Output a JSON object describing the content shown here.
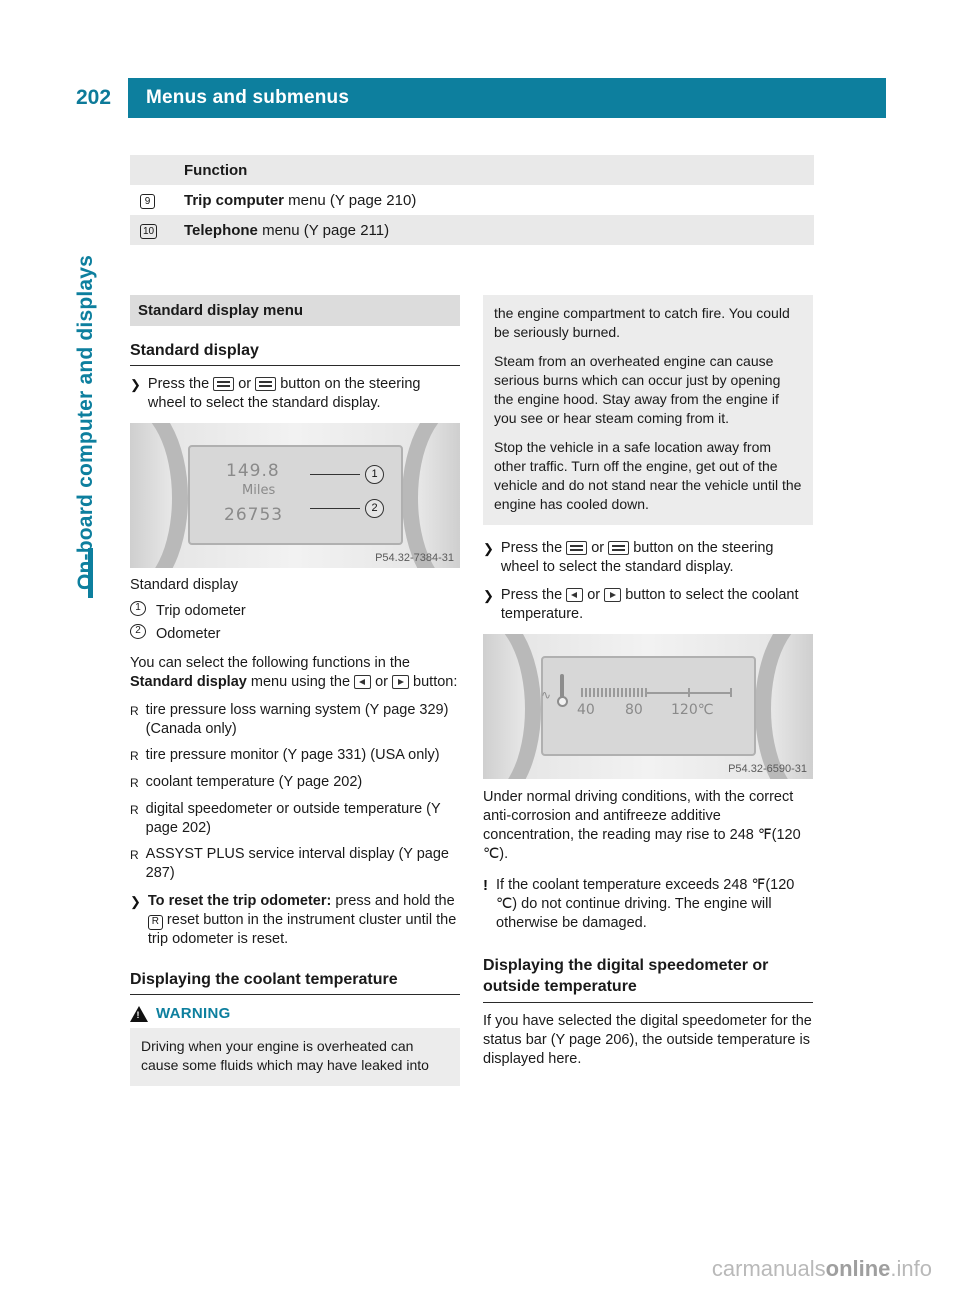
{
  "header": {
    "page_number": "202",
    "title": "Menus and submenus"
  },
  "side_title": "On-board computer and displays",
  "function_table": {
    "header": "Function",
    "rows": [
      {
        "symbol": "9",
        "label_bold": "Trip computer",
        "label_rest": " menu (Y page 210)"
      },
      {
        "symbol": "10",
        "label_bold": "Telephone",
        "label_rest": " menu (Y page 211)"
      }
    ]
  },
  "left": {
    "section_title": "Standard display menu",
    "subhead_standard_display": "Standard display",
    "press_button_text": "button on the steering wheel to select the standard display.",
    "press_prefix": "Press the",
    "or_word": "or",
    "illustration1": {
      "line1": "149.8",
      "line2": "Miles",
      "line3": "26753",
      "callout1": "1",
      "callout2": "2",
      "code": "P54.32-7384-31"
    },
    "legend_title": "Standard display",
    "legend": [
      {
        "mark": "1",
        "text": "Trip odometer"
      },
      {
        "mark": "2",
        "text": "Odometer"
      }
    ],
    "select_intro_a": "You can select the following functions in the ",
    "select_intro_bold": "Standard display",
    "select_intro_b": " menu using the ",
    "select_intro_c": " or ",
    "select_intro_d": " button:",
    "function_bullets": [
      "tire pressure loss warning system (Y page 329) (Canada only)",
      "tire pressure monitor (Y page 331) (USA only)",
      "coolant temperature (Y page 202)",
      "digital speedometer or outside temperature (Y page 202)",
      "ASSYST PLUS service interval display (Y page 287)"
    ],
    "reset_bold": "To reset the trip odometer:",
    "reset_text_a": " press and hold the ",
    "reset_text_b": " reset button in the instrument cluster until the trip odometer is reset.",
    "subhead_coolant": "Displaying the coolant temperature",
    "warning_label": "WARNING",
    "warning_text_1": "Driving when your engine is overheated can cause some fluids which may have leaked into"
  },
  "right": {
    "warning_continued": [
      "the engine compartment to catch fire. You could be seriously burned.",
      "Steam from an overheated engine can cause serious burns which can occur just by opening the engine hood. Stay away from the engine if you see or hear steam coming from it.",
      "Stop the vehicle in a safe location away from other traffic. Turn off the engine, get out of the vehicle and do not stand near the vehicle until the engine has cooled down."
    ],
    "press_prefix": "Press the",
    "or_word": "or",
    "press_button_text": "button on the steering wheel to select the standard display.",
    "press_select_text": "button to select the coolant temperature.",
    "illustration2": {
      "labels": [
        "40",
        "80",
        "120℃"
      ],
      "code": "P54.32-6590-31"
    },
    "body_1": "Under normal driving conditions, with the correct anti-corrosion and antifreeze additive concentration, the reading may rise to 248 ℉(120 ℃).",
    "note_1": "If the coolant temperature exceeds 248 ℉(120 ℃) do not continue driving. The engine will otherwise be damaged.",
    "subhead_speedo": "Displaying the digital speedometer or outside temperature",
    "body_2": "If you have selected the digital speedometer for the status bar (Y page 206), the outside temperature is displayed here."
  },
  "watermark": {
    "plain": "carmanuals",
    "bold": "online",
    "suffix": ".info"
  },
  "colors": {
    "accent": "#0d7f9e",
    "shade_row": "#e9e9e9",
    "section_head": "#dcdcdc"
  }
}
